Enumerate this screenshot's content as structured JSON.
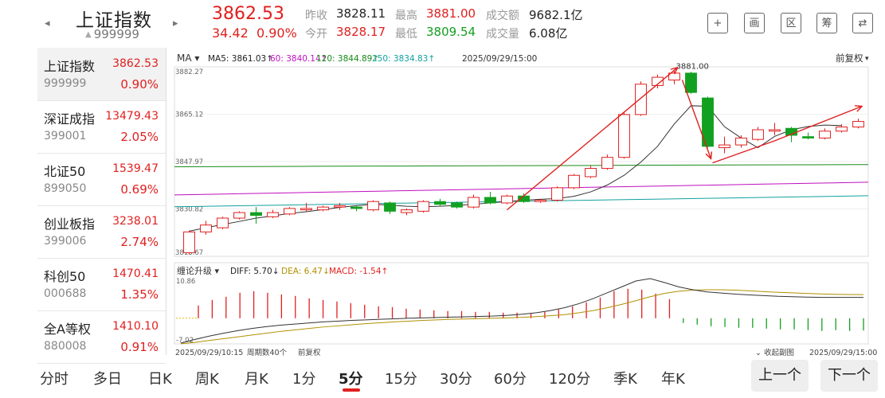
{
  "header": {
    "title": "上证指数",
    "code": "999999",
    "price": "3862.53",
    "change": "34.42",
    "change_pct": "0.90%",
    "stats": [
      {
        "label": "昨收",
        "value": "3828.11",
        "color": "#222222"
      },
      {
        "label": "最高",
        "value": "3881.00",
        "color": "#e0201f"
      },
      {
        "label": "成交额",
        "value": "9682.1亿",
        "color": "#222222"
      },
      {
        "label": "今开",
        "value": "3828.17",
        "color": "#e0201f"
      },
      {
        "label": "最低",
        "value": "3809.54",
        "color": "#12a020"
      },
      {
        "label": "成交量",
        "value": "6.08亿",
        "color": "#222222"
      }
    ],
    "toolbar": [
      {
        "name": "add-icon",
        "glyph": "+"
      },
      {
        "name": "draw-icon",
        "glyph": "画"
      },
      {
        "name": "range-icon",
        "glyph": "区"
      },
      {
        "name": "chip-icon",
        "glyph": "筹"
      },
      {
        "name": "layout-toggle-icon",
        "glyph": "⇄"
      }
    ]
  },
  "sidebar": {
    "items": [
      {
        "name": "上证指数",
        "code": "999999",
        "price": "3862.53",
        "pct": "0.90%"
      },
      {
        "name": "深证成指",
        "code": "399001",
        "price": "13479.43",
        "pct": "2.05%"
      },
      {
        "name": "北证50",
        "code": "899050",
        "price": "1539.47",
        "pct": "0.69%"
      },
      {
        "name": "创业板指",
        "code": "399006",
        "price": "3238.01",
        "pct": "2.74%"
      },
      {
        "name": "科创50",
        "code": "000688",
        "price": "1470.41",
        "pct": "1.35%"
      },
      {
        "name": "全A等权",
        "code": "880008",
        "price": "1410.10",
        "pct": "0.91%"
      }
    ]
  },
  "chart": {
    "ma_selector": "MA",
    "ma_legend": [
      {
        "text": "MA5: 3861.03↑",
        "color": "#222222"
      },
      {
        "text": "60: 3840.14↑",
        "color": "#c010c0"
      },
      {
        "text": "120: 3844.89↑",
        "color": "#1a8a1a"
      },
      {
        "text": "250: 3834.83↑",
        "color": "#14a0a0"
      }
    ],
    "datetime": "2025/09/29/15:00",
    "adjust": "前复权",
    "price_labels": [
      "3882.27",
      "3865.12",
      "3847.97",
      "3830.82",
      "3813.67"
    ],
    "high_annotation": "3881.00",
    "indicator_selector": "缠论升级",
    "macd_legend": [
      {
        "text": "DIFF: 5.70↓",
        "color": "#222222"
      },
      {
        "text": "DEA: 6.47↓",
        "color": "#b09000"
      },
      {
        "text": "MACD: -1.54↑",
        "color": "#e0201f"
      }
    ],
    "macd_labels": [
      "10.86",
      "-7.02"
    ],
    "footer_left": "2025/09/29/10:15",
    "footer_period": "周期数40个",
    "footer_adjust": "前复权",
    "footer_collapse": "收起副图",
    "footer_right": "2025/09/29/15:00"
  },
  "chart_data": {
    "type": "candlestick",
    "title": "",
    "y_range": [
      3813.67,
      3882.27
    ],
    "ma_lines": {
      "MA5": [
        3822.8,
        3824.0,
        3825.2,
        3826.3,
        3827.5,
        3828.3,
        3829.2,
        3829.8,
        3830.6,
        3831.4,
        3832.0,
        3832.5,
        3832.2,
        3831.8,
        3831.6,
        3831.8,
        3832.1,
        3832.5,
        3833.0,
        3833.5,
        3834.0,
        3834.3,
        3834.6,
        3835.4,
        3837.0,
        3839.5,
        3843.0,
        3847.8,
        3853.5,
        3861.6,
        3868.2,
        3868.0,
        3860.6,
        3856.5,
        3853.0,
        3857.1,
        3859.5,
        3860.7,
        3861.2,
        3861.0
      ],
      "MA60": 3838.2,
      "MA120": 3846.5,
      "MA250": 3833.6
    },
    "candles": [
      {
        "o": 3815.0,
        "c": 3822.5,
        "h": 3823.0,
        "l": 3814.5
      },
      {
        "o": 3822.5,
        "c": 3825.0,
        "h": 3826.5,
        "l": 3821.5
      },
      {
        "o": 3824.0,
        "c": 3827.5,
        "h": 3828.0,
        "l": 3823.5
      },
      {
        "o": 3827.5,
        "c": 3829.5,
        "h": 3830.0,
        "l": 3827.0
      },
      {
        "o": 3829.5,
        "c": 3828.5,
        "h": 3831.5,
        "l": 3825.5
      },
      {
        "o": 3828.0,
        "c": 3829.5,
        "h": 3830.5,
        "l": 3827.5
      },
      {
        "o": 3829.0,
        "c": 3831.0,
        "h": 3831.5,
        "l": 3828.5
      },
      {
        "o": 3830.5,
        "c": 3831.0,
        "h": 3833.0,
        "l": 3830.0
      },
      {
        "o": 3830.5,
        "c": 3831.5,
        "h": 3832.0,
        "l": 3830.0
      },
      {
        "o": 3831.5,
        "c": 3832.0,
        "h": 3833.0,
        "l": 3830.5
      },
      {
        "o": 3831.5,
        "c": 3831.0,
        "h": 3832.0,
        "l": 3830.0
      },
      {
        "o": 3830.5,
        "c": 3833.5,
        "h": 3834.0,
        "l": 3830.0
      },
      {
        "o": 3833.0,
        "c": 3830.0,
        "h": 3833.5,
        "l": 3829.0
      },
      {
        "o": 3829.5,
        "c": 3830.5,
        "h": 3831.0,
        "l": 3828.5
      },
      {
        "o": 3830.0,
        "c": 3833.5,
        "h": 3834.0,
        "l": 3829.5
      },
      {
        "o": 3833.5,
        "c": 3832.5,
        "h": 3834.5,
        "l": 3832.0
      },
      {
        "o": 3833.0,
        "c": 3831.5,
        "h": 3833.5,
        "l": 3831.0
      },
      {
        "o": 3831.5,
        "c": 3835.0,
        "h": 3836.0,
        "l": 3831.0
      },
      {
        "o": 3835.0,
        "c": 3833.0,
        "h": 3837.0,
        "l": 3832.5
      },
      {
        "o": 3833.0,
        "c": 3835.5,
        "h": 3836.0,
        "l": 3832.5
      },
      {
        "o": 3835.5,
        "c": 3833.5,
        "h": 3836.5,
        "l": 3833.0
      },
      {
        "o": 3833.5,
        "c": 3834.0,
        "h": 3834.5,
        "l": 3833.0
      },
      {
        "o": 3834.0,
        "c": 3838.5,
        "h": 3839.0,
        "l": 3833.5
      },
      {
        "o": 3838.5,
        "c": 3843.0,
        "h": 3843.5,
        "l": 3838.0
      },
      {
        "o": 3842.5,
        "c": 3845.5,
        "h": 3846.5,
        "l": 3842.0
      },
      {
        "o": 3845.5,
        "c": 3849.5,
        "h": 3850.5,
        "l": 3845.0
      },
      {
        "o": 3849.5,
        "c": 3865.0,
        "h": 3866.0,
        "l": 3849.0
      },
      {
        "o": 3865.0,
        "c": 3876.0,
        "h": 3877.0,
        "l": 3864.5
      },
      {
        "o": 3875.5,
        "c": 3878.5,
        "h": 3879.5,
        "l": 3874.5
      },
      {
        "o": 3877.5,
        "c": 3880.0,
        "h": 3881.0,
        "l": 3876.0
      },
      {
        "o": 3880.0,
        "c": 3873.0,
        "h": 3880.5,
        "l": 3872.5
      },
      {
        "o": 3871.0,
        "c": 3853.5,
        "h": 3871.5,
        "l": 3853.0
      },
      {
        "o": 3853.0,
        "c": 3854.0,
        "h": 3857.0,
        "l": 3851.0
      },
      {
        "o": 3854.0,
        "c": 3856.5,
        "h": 3857.5,
        "l": 3853.0
      },
      {
        "o": 3856.0,
        "c": 3859.5,
        "h": 3860.5,
        "l": 3855.5
      },
      {
        "o": 3859.0,
        "c": 3859.5,
        "h": 3862.0,
        "l": 3857.5
      },
      {
        "o": 3860.0,
        "c": 3857.5,
        "h": 3860.5,
        "l": 3855.0
      },
      {
        "o": 3857.0,
        "c": 3856.5,
        "h": 3858.5,
        "l": 3856.0
      },
      {
        "o": 3856.5,
        "c": 3859.0,
        "h": 3860.0,
        "l": 3856.0
      },
      {
        "o": 3859.0,
        "c": 3860.5,
        "h": 3861.5,
        "l": 3858.5
      },
      {
        "o": 3860.5,
        "c": 3862.5,
        "h": 3863.5,
        "l": 3860.0
      }
    ],
    "macd": {
      "y_range": [
        -7.02,
        10.86
      ],
      "hist": [
        1.6,
        2.3,
        2.7,
        3.2,
        3.4,
        3.2,
        3.0,
        2.8,
        2.5,
        2.3,
        2.1,
        1.9,
        1.7,
        1.5,
        1.4,
        1.2,
        1.1,
        1.0,
        0.9,
        0.9,
        0.8,
        0.8,
        0.7,
        0.7,
        0.6,
        0.8,
        1.1,
        1.5,
        2.0,
        2.6,
        3.4,
        3.7,
        3.6,
        3.1,
        2.4,
        -0.6,
        -0.8,
        -1.0,
        -1.1,
        -1.2,
        -1.2,
        -1.3,
        -1.4,
        -1.4,
        -1.5,
        -1.6,
        -1.5,
        -1.6,
        -1.54
      ],
      "diff": [
        -6.8,
        -5.8,
        -4.9,
        -4.1,
        -3.4,
        -2.8,
        -2.3,
        -1.9,
        -1.6,
        -1.3,
        -1.0,
        -0.8,
        -0.6,
        -0.45,
        -0.3,
        -0.15,
        0.0,
        0.1,
        0.2,
        0.3,
        0.4,
        0.5,
        0.6,
        0.8,
        1.1,
        1.5,
        2.1,
        2.9,
        4.0,
        5.4,
        7.0,
        8.6,
        10.2,
        10.86,
        9.8,
        8.6,
        7.8,
        7.2,
        6.9,
        6.6,
        6.4,
        6.2,
        6.0,
        5.9,
        5.8,
        5.7,
        5.7,
        5.7,
        5.7
      ],
      "dea": [
        -7.0,
        -6.6,
        -6.1,
        -5.6,
        -5.1,
        -4.6,
        -4.1,
        -3.6,
        -3.2,
        -2.8,
        -2.4,
        -2.1,
        -1.8,
        -1.5,
        -1.25,
        -1.0,
        -0.8,
        -0.6,
        -0.45,
        -0.3,
        -0.2,
        -0.1,
        0.0,
        0.1,
        0.25,
        0.45,
        0.7,
        1.0,
        1.5,
        2.1,
        2.9,
        3.8,
        4.8,
        5.9,
        6.8,
        7.4,
        7.7,
        7.8,
        7.8,
        7.7,
        7.5,
        7.3,
        7.1,
        6.95,
        6.8,
        6.65,
        6.55,
        6.5,
        6.47
      ]
    }
  },
  "periods": {
    "items": [
      "分时",
      "多日",
      "日K",
      "周K",
      "月K",
      "1分",
      "5分",
      "15分",
      "30分",
      "60分",
      "120分",
      "季K",
      "年K"
    ],
    "active": "5分"
  },
  "nav": {
    "prev": "上一个",
    "next": "下一个"
  }
}
